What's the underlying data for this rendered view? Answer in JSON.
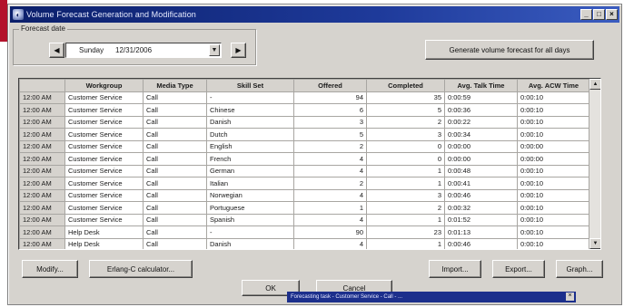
{
  "window": {
    "title": "Volume Forecast Generation and Modification",
    "buttons": {
      "minimize": "_",
      "maximize": "□",
      "close": "×"
    }
  },
  "forecast_date": {
    "label": "Forecast date",
    "day": "Sunday",
    "date": "12/31/2006"
  },
  "generate_button": "Generate volume forecast for all days",
  "table": {
    "columns": [
      "",
      "Workgroup",
      "Media Type",
      "Skill Set",
      "Offered",
      "Completed",
      "Avg. Talk Time",
      "Avg. ACW Time"
    ],
    "rows": [
      [
        "12:00 AM",
        "Customer Service",
        "Call",
        "-",
        "94",
        "35",
        "0:00:59",
        "0:00:10"
      ],
      [
        "12:00 AM",
        "Customer Service",
        "Call",
        "Chinese",
        "6",
        "5",
        "0:00:36",
        "0:00:10"
      ],
      [
        "12:00 AM",
        "Customer Service",
        "Call",
        "Danish",
        "3",
        "2",
        "0:00:22",
        "0:00:10"
      ],
      [
        "12:00 AM",
        "Customer Service",
        "Call",
        "Dutch",
        "5",
        "3",
        "0:00:34",
        "0:00:10"
      ],
      [
        "12:00 AM",
        "Customer Service",
        "Call",
        "English",
        "2",
        "0",
        "0:00:00",
        "0:00:00"
      ],
      [
        "12:00 AM",
        "Customer Service",
        "Call",
        "French",
        "4",
        "0",
        "0:00:00",
        "0:00:00"
      ],
      [
        "12:00 AM",
        "Customer Service",
        "Call",
        "German",
        "4",
        "1",
        "0:00:48",
        "0:00:10"
      ],
      [
        "12:00 AM",
        "Customer Service",
        "Call",
        "Italian",
        "2",
        "1",
        "0:00:41",
        "0:00:10"
      ],
      [
        "12:00 AM",
        "Customer Service",
        "Call",
        "Norwegian",
        "4",
        "3",
        "0:00:46",
        "0:00:10"
      ],
      [
        "12:00 AM",
        "Customer Service",
        "Call",
        "Portuguese",
        "1",
        "2",
        "0:00:32",
        "0:00:10"
      ],
      [
        "12:00 AM",
        "Customer Service",
        "Call",
        "Spanish",
        "4",
        "1",
        "0:01:52",
        "0:00:10"
      ],
      [
        "12:00 AM",
        "Help Desk",
        "Call",
        "-",
        "90",
        "23",
        "0:01:13",
        "0:00:10"
      ],
      [
        "12:00 AM",
        "Help Desk",
        "Call",
        "Danish",
        "4",
        "1",
        "0:00:46",
        "0:00:10"
      ]
    ]
  },
  "buttons": {
    "modify": "Modify...",
    "erlang": "Erlang-C calculator...",
    "import": "Import...",
    "export": "Export...",
    "graph": "Graph...",
    "ok": "OK",
    "cancel": "Cancel"
  },
  "status_popup": {
    "text": "Forecasting task - Customer Service - Call - ...",
    "close": "×"
  }
}
